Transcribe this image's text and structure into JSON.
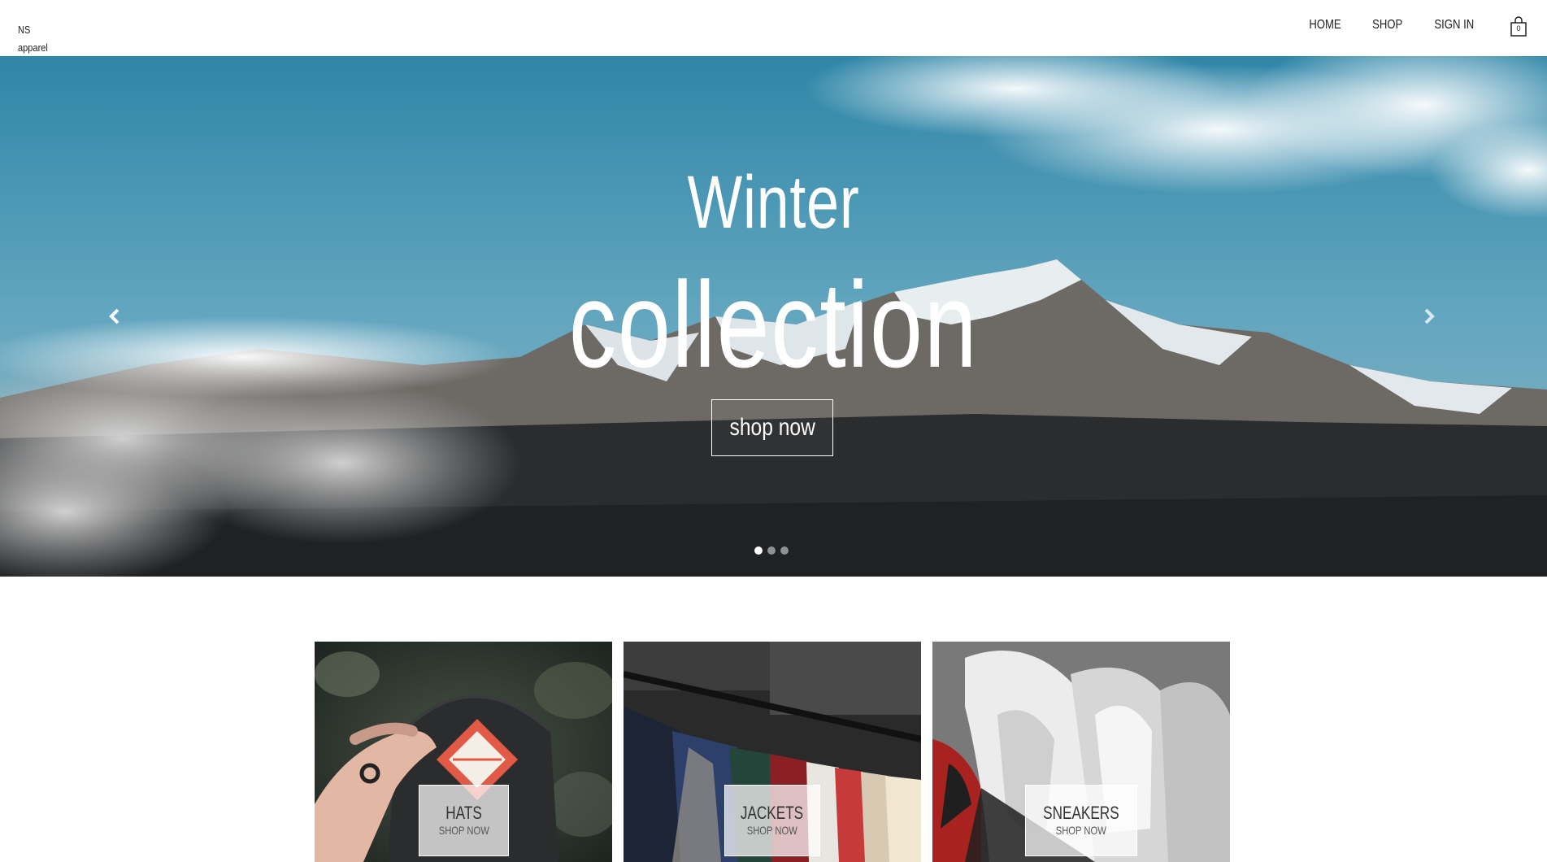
{
  "nav": {
    "logo_line1": "NS",
    "logo_line2": "apparel",
    "links": [
      {
        "label": "HOME"
      },
      {
        "label": "SHOP"
      },
      {
        "label": "SIGN IN"
      }
    ],
    "cart_icon": "shopping-bag-icon",
    "cart_count": "0"
  },
  "hero": {
    "title_line1": "Winter",
    "title_line2": "collection",
    "button_label": "shop now",
    "prev_icon": "chevron-left-icon",
    "next_icon": "chevron-right-icon",
    "slide_count": 3,
    "active_slide": 1
  },
  "categories": [
    {
      "title": "HATS",
      "cta": "SHOP NOW"
    },
    {
      "title": "JACKETS",
      "cta": "SHOP NOW"
    },
    {
      "title": "SNEAKERS",
      "cta": "SHOP NOW"
    }
  ],
  "colors": {
    "sky": "#4f9bb9",
    "text_dark": "#222222",
    "white": "#ffffff"
  }
}
